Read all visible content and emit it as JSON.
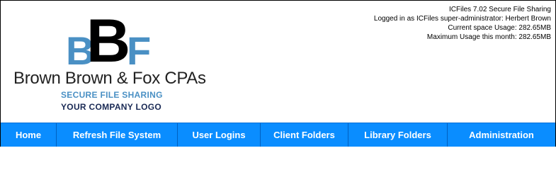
{
  "logo": {
    "letter_1": "B",
    "letter_2": "B",
    "letter_3": "F",
    "company_name": "Brown Brown & Fox CPAs",
    "tagline_1": "SECURE FILE SHARING",
    "tagline_2": "YOUR COMPANY LOGO"
  },
  "info": {
    "product": "ICFiles 7.02 Secure File Sharing",
    "logged_in": "Logged in as ICFiles super-administrator: Herbert Brown",
    "current_usage": "Current space Usage: 282.65MB",
    "max_usage": "Maximum Usage this month: 282.65MB"
  },
  "nav": {
    "items": [
      {
        "label": "Home"
      },
      {
        "label": "Refresh File System"
      },
      {
        "label": "User Logins"
      },
      {
        "label": "Client Folders"
      },
      {
        "label": "Library Folders"
      },
      {
        "label": "Administration"
      }
    ]
  },
  "colors": {
    "nav_background": "#0a8dff",
    "logo_blue": "#4a90c4",
    "logo_dark": "#000000",
    "tagline_dark": "#1a2a55"
  }
}
